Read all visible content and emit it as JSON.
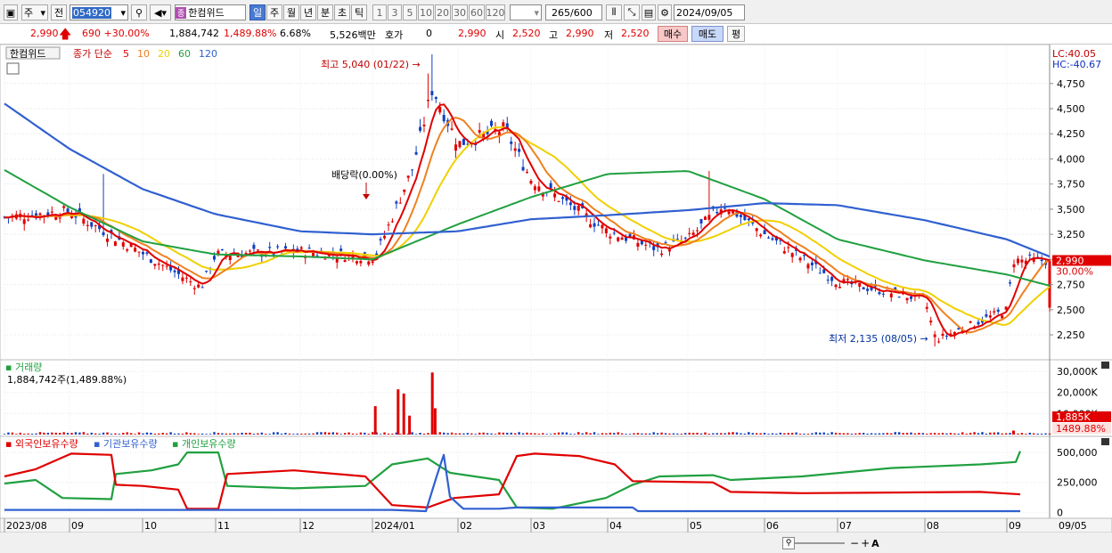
{
  "toolbar": {
    "market_label": "주",
    "all_label": "전",
    "code_value": "054920",
    "stock_name": "한컴위드",
    "periods": [
      "일",
      "주",
      "월",
      "년",
      "분",
      "초",
      "틱"
    ],
    "selected_period": "일",
    "intervals": [
      "1",
      "3",
      "5",
      "10",
      "20",
      "30",
      "60",
      "120"
    ],
    "count_value": "265",
    "count_total": "/600",
    "date_value": "2024/09/05"
  },
  "quote": {
    "price": "2,990",
    "change": "690 +30.00%",
    "volume": "1,884,742",
    "vol_ratio": "1,489.88%",
    "turnover": "6.68%",
    "amount": "5,526백만",
    "hoga_label": "호가",
    "hoga_value": "0",
    "hoga_price": "2,990",
    "open_label": "시",
    "open": "2,520",
    "high_label": "고",
    "high": "2,990",
    "low_label": "저",
    "low": "2,520",
    "buy_label": "매수",
    "sell_label": "매도",
    "eval_label": "평"
  },
  "chart_data": [
    {
      "type": "candlestick",
      "title": "한컴위드",
      "legend": {
        "prefix": "종가 단순",
        "periods": [
          "5",
          "10",
          "20",
          "60",
          "120"
        ],
        "colors": [
          "#e00000",
          "#f08020",
          "#f0d000",
          "#20a040",
          "#3060d0"
        ]
      },
      "y_ticks": [
        2250,
        2500,
        2750,
        3000,
        3250,
        3500,
        3750,
        4000,
        4250,
        4500,
        4750
      ],
      "y_tick_labels": [
        "2,250",
        "2,500",
        "2,750",
        "3,000",
        "3,250",
        "3,500",
        "3,750",
        "4,000",
        "4,250",
        "4,500",
        "4,750"
      ],
      "ylim": [
        2020,
        5120
      ],
      "x_labels": [
        "2023/08",
        "09",
        "10",
        "11",
        "12",
        "2024/01",
        "02",
        "03",
        "04",
        "05",
        "06",
        "07",
        "08",
        "09",
        "09/05"
      ],
      "corner_labels": [
        "LC:40.05",
        "HC:-40.67"
      ],
      "last_price_tag": "2,990",
      "last_change_tag": "30.00%",
      "annotations": [
        {
          "text": "최고 5,040 (01/22)",
          "value": 5040
        },
        {
          "text": "배당락(0.00%)",
          "value": 3720
        },
        {
          "text": "최저 2,135 (08/05)",
          "value": 2135
        }
      ],
      "ohlc_anchors": [
        {
          "date": "2023/08",
          "close": 3420
        },
        {
          "date": "2023/09",
          "close": 3480
        },
        {
          "date": "2023/10",
          "close": 3060
        },
        {
          "date": "2023/10/25",
          "close": 2720
        },
        {
          "date": "2023/11",
          "close": 3050
        },
        {
          "date": "2023/12",
          "close": 3080
        },
        {
          "date": "2024/01/02",
          "close": 3020
        },
        {
          "date": "2024/01/15",
          "close": 3900
        },
        {
          "date": "2024/01/22",
          "close": 4700
        },
        {
          "date": "2024/02",
          "close": 4150
        },
        {
          "date": "2024/02/20",
          "close": 4300
        },
        {
          "date": "2024/03",
          "close": 3800
        },
        {
          "date": "2024/04",
          "close": 3280
        },
        {
          "date": "2024/04/20",
          "close": 3100
        },
        {
          "date": "2024/05",
          "close": 3200
        },
        {
          "date": "2024/05/15",
          "close": 3550
        },
        {
          "date": "2024/06",
          "close": 3250
        },
        {
          "date": "2024/07",
          "close": 2780
        },
        {
          "date": "2024/08",
          "close": 2600
        },
        {
          "date": "2024/08/05",
          "close": 2200
        },
        {
          "date": "2024/09",
          "close": 2500
        },
        {
          "date": "2024/09/05",
          "close": 2990
        }
      ],
      "ma_anchors": {
        "ma60": [
          3890,
          3520,
          3180,
          3050,
          3030,
          3000,
          3350,
          3620,
          3850,
          3880,
          3600,
          3200,
          2990,
          2850,
          2720
        ],
        "ma120": [
          4550,
          4100,
          3700,
          3450,
          3280,
          3250,
          3280,
          3400,
          3440,
          3490,
          3560,
          3540,
          3390,
          3200,
          3000
        ]
      }
    },
    {
      "type": "bar",
      "title": "거래량",
      "readout": "1,884,742주(1,489.88%)",
      "y_ticks": [
        10000,
        20000,
        30000
      ],
      "y_tick_labels": [
        "10,000K",
        "20,000K",
        "30,000K"
      ],
      "last_value_tag": "1,885K",
      "last_ratio_tag": "1489.88%",
      "spikes_k": [
        {
          "date": "2024/01/02",
          "value": 13500
        },
        {
          "date": "2024/01/10",
          "value": 21500
        },
        {
          "date": "2024/01/12",
          "value": 19500
        },
        {
          "date": "2024/01/14",
          "value": 9000
        },
        {
          "date": "2024/01/22",
          "value": 29500
        },
        {
          "date": "2024/01/23",
          "value": 12500
        },
        {
          "date": "2024/09/05",
          "value": 1885
        }
      ]
    },
    {
      "type": "line",
      "series": [
        {
          "name": "외국인보유수량",
          "color": "#e00000"
        },
        {
          "name": "기관보유수량",
          "color": "#3060d0"
        },
        {
          "name": "개인보유수량",
          "color": "#20a040"
        }
      ],
      "y_ticks": [
        0,
        250000,
        500000
      ],
      "y_tick_labels": [
        "0",
        "250,000",
        "500,000"
      ]
    }
  ],
  "nav": {
    "zoom_out": "−",
    "zoom_in": "+"
  }
}
